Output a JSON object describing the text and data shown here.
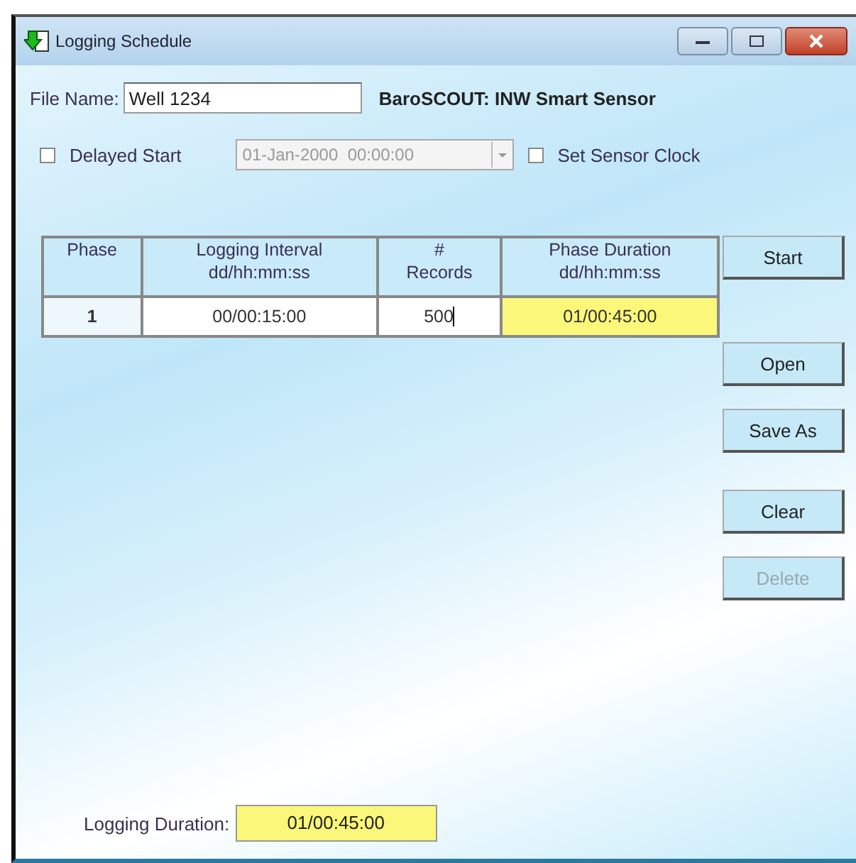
{
  "window": {
    "title": "Logging Schedule"
  },
  "file_name": {
    "label": "File Name:",
    "value": "Well 1234"
  },
  "device_label": "BaroSCOUT: INW Smart Sensor",
  "delayed_start": {
    "label": "Delayed Start",
    "checked": false
  },
  "start_time": {
    "value": "01-Jan-2000  00:00:00",
    "disabled": true
  },
  "set_sensor_clock": {
    "label": "Set Sensor Clock",
    "checked": false
  },
  "table": {
    "columns": [
      [
        "Phase"
      ],
      [
        "Logging Interval",
        "dd/hh:mm:ss"
      ],
      [
        "#",
        "Records"
      ],
      [
        "Phase Duration",
        "dd/hh:mm:ss"
      ]
    ],
    "rows": [
      {
        "phase": "1",
        "interval": "00/00:15:00",
        "records": "500",
        "duration": "01/00:45:00"
      }
    ]
  },
  "buttons": [
    {
      "label": "Start",
      "disabled": false
    },
    {
      "label": "Open",
      "disabled": false
    },
    {
      "label": "Save As",
      "disabled": false
    },
    {
      "label": "Clear",
      "disabled": false
    },
    {
      "label": "Delete",
      "disabled": true
    }
  ],
  "logging_duration": {
    "label": "Logging Duration:",
    "value": "01/00:45:00"
  }
}
